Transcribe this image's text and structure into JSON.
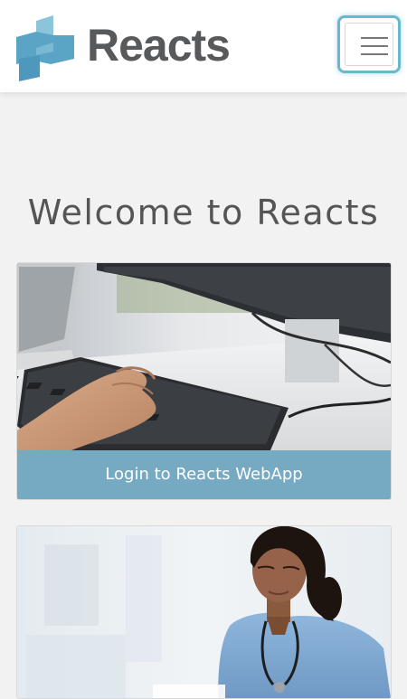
{
  "header": {
    "brand_name": "Reacts",
    "menu_icon": "hamburger-menu-icon",
    "brand_color": "#58595b",
    "logo_color": "#6ab2cc",
    "focus_ring_color": "#69b8cb"
  },
  "main": {
    "welcome_title": "Welcome to Reacts",
    "cards": [
      {
        "image": "computer-keyboard-typing-photo",
        "button_label": "Login to Reacts WebApp",
        "button_color": "#76a9c2"
      },
      {
        "image": "nurse-with-stethoscope-photo"
      }
    ]
  }
}
